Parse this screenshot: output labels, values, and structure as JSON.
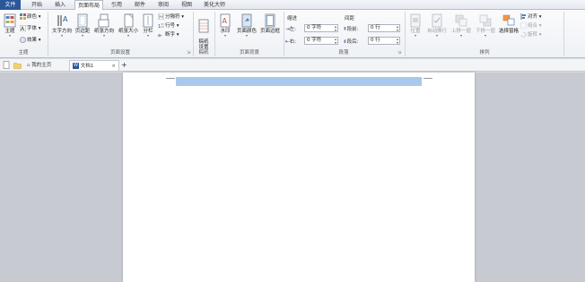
{
  "tabs": [
    {
      "label": "文件"
    },
    {
      "label": "开始"
    },
    {
      "label": "插入"
    },
    {
      "label": "页面布局"
    },
    {
      "label": "引用"
    },
    {
      "label": "邮件"
    },
    {
      "label": "审阅"
    },
    {
      "label": "视图"
    },
    {
      "label": "美化大师"
    }
  ],
  "ribbon": {
    "theme": {
      "label": "主题",
      "main": "主题",
      "colors": "颜色",
      "fonts": "字体",
      "effects": "效果"
    },
    "page_setup": {
      "label": "页面设置",
      "text_direction": "文字方向",
      "margins": "页边距",
      "orientation": "纸张方向",
      "size": "纸张大小",
      "columns": "分栏",
      "breaks": "分隔符",
      "line_numbers": "行号",
      "hyphenation": "断字"
    },
    "draft": {
      "label": "稿纸",
      "settings": "稿纸\n设置"
    },
    "page_background": {
      "label": "页面背景",
      "watermark": "水印",
      "page_color": "页面颜色",
      "page_borders": "页面边框"
    },
    "paragraph": {
      "label": "段落",
      "indent_title": "缩进",
      "spacing_title": "间距",
      "left_label": "左:",
      "left_value": "0 字符",
      "right_label": "右:",
      "right_value": "0 字符",
      "before_label": "段前:",
      "before_value": "0 行",
      "after_label": "段后:",
      "after_value": "0 行"
    },
    "arrange": {
      "label": "排列",
      "position": "位置",
      "wrap_text": "自动换行",
      "bring_forward": "上移一层",
      "send_backward": "下移一层",
      "selection_pane": "选择窗格",
      "align": "对齐",
      "group": "组合",
      "rotate": "旋转"
    }
  },
  "doc_tabs": {
    "home": "我的主页",
    "doc1": "文档1",
    "close": "×",
    "add": "+"
  },
  "colors": {
    "file_tab": "#2b579a",
    "selection": "#a9c9ec"
  }
}
